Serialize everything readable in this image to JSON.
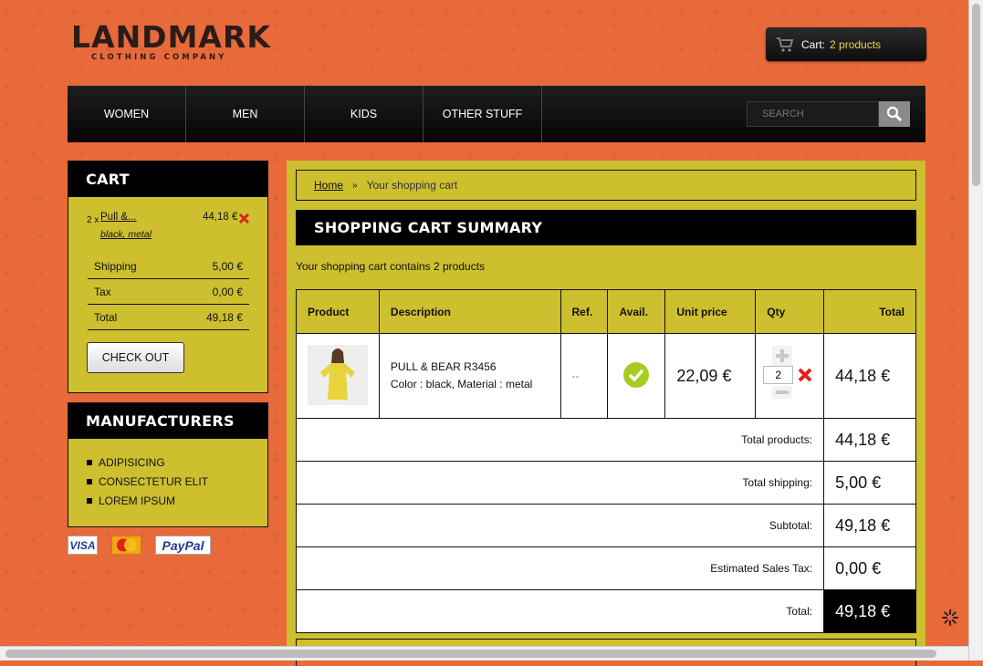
{
  "brand": {
    "name": "LANDMARK",
    "tagline": "CLOTHING COMPANY"
  },
  "header_cart": {
    "label": "Cart:",
    "count": "2 products"
  },
  "nav": {
    "items": [
      {
        "label": "WOMEN"
      },
      {
        "label": "MEN"
      },
      {
        "label": "KIDS"
      },
      {
        "label": "OTHER STUFF"
      }
    ],
    "search_placeholder": "SEARCH"
  },
  "sidebar_cart": {
    "title": "CART",
    "item": {
      "qty": "2 x",
      "name": "Pull &...",
      "attributes": "black, metal",
      "price": "44,18 €"
    },
    "rows": [
      {
        "label": "Shipping",
        "value": "5,00 €"
      },
      {
        "label": "Tax",
        "value": "0,00 €"
      },
      {
        "label": "Total",
        "value": "49,18 €"
      }
    ],
    "checkout_label": "CHECK OUT"
  },
  "manufacturers": {
    "title": "MANUFACTURERS",
    "items": [
      "ADIPISICING",
      "CONSECTETUR ELIT",
      "LOREM IPSUM"
    ]
  },
  "payments": [
    "VISA",
    "MasterCard",
    "PayPal"
  ],
  "breadcrumb": {
    "home": "Home",
    "separator": "»",
    "current": "Your shopping cart"
  },
  "summary": {
    "title": "SHOPPING CART SUMMARY",
    "contains_text": "Your shopping cart contains 2 products",
    "columns": [
      "Product",
      "Description",
      "Ref.",
      "Avail.",
      "Unit price",
      "Qty",
      "Total"
    ],
    "product": {
      "name": "PULL & BEAR R3456",
      "attributes": "Color : black, Material : metal",
      "ref": "--",
      "unit_price": "22,09 €",
      "qty": "2",
      "total": "44,18 €"
    },
    "totals": [
      {
        "label": "Total products:",
        "value": "44,18 €"
      },
      {
        "label": "Total shipping:",
        "value": "5,00 €"
      },
      {
        "label": "Subtotal:",
        "value": "49,18 €"
      },
      {
        "label": "Estimated Sales Tax:",
        "value": "0,00 €"
      },
      {
        "label": "Total:",
        "value": "49,18 €"
      }
    ]
  },
  "colors": {
    "background": "#e8693a",
    "panel": "#cdbf2e",
    "accent": "#f2d23a",
    "dark": "#000000"
  }
}
